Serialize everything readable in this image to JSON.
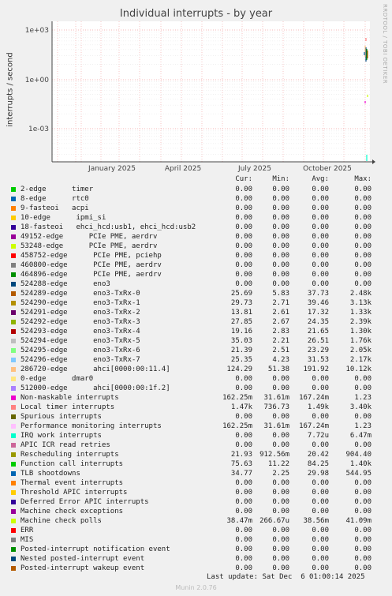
{
  "title": "Individual interrupts - by year",
  "side_label": "RRDTOOL / TOBI OETIKER",
  "chart_data": {
    "type": "line",
    "title": "Individual interrupts - by year",
    "ylabel": "interrupts / second",
    "yscale": "log",
    "y_ticks": [
      "1e+03",
      "1e+00",
      "1e-03"
    ],
    "x_ticks": [
      "January 2025",
      "April 2025",
      "July 2025",
      "October 2025"
    ],
    "grid": true,
    "series_note": "data present only at the far right end of the time range"
  },
  "headers": {
    "cur": "Cur:",
    "min": "Min:",
    "avg": "Avg:",
    "max": "Max:"
  },
  "legend": [
    {
      "label": "2-edge      timer",
      "color": "#00cc00",
      "cur": "0.00",
      "min": "0.00",
      "avg": "0.00",
      "max": "0.00"
    },
    {
      "label": "8-edge      rtc0",
      "color": "#0066b3",
      "cur": "0.00",
      "min": "0.00",
      "avg": "0.00",
      "max": "0.00"
    },
    {
      "label": "9-fasteoi   acpi",
      "color": "#ff8000",
      "cur": "0.00",
      "min": "0.00",
      "avg": "0.00",
      "max": "0.00"
    },
    {
      "label": "10-edge      ipmi_si",
      "color": "#ffcc00",
      "cur": "0.00",
      "min": "0.00",
      "avg": "0.00",
      "max": "0.00"
    },
    {
      "label": "18-fasteoi   ehci_hcd:usb1, ehci_hcd:usb2",
      "color": "#330099",
      "cur": "0.00",
      "min": "0.00",
      "avg": "0.00",
      "max": "0.00"
    },
    {
      "label": "49152-edge      PCIe PME, aerdrv",
      "color": "#990099",
      "cur": "0.00",
      "min": "0.00",
      "avg": "0.00",
      "max": "0.00"
    },
    {
      "label": "53248-edge      PCIe PME, aerdrv",
      "color": "#ccff00",
      "cur": "0.00",
      "min": "0.00",
      "avg": "0.00",
      "max": "0.00"
    },
    {
      "label": "458752-edge      PCIe PME, pciehp",
      "color": "#ff0000",
      "cur": "0.00",
      "min": "0.00",
      "avg": "0.00",
      "max": "0.00"
    },
    {
      "label": "460800-edge      PCIe PME, aerdrv",
      "color": "#808080",
      "cur": "0.00",
      "min": "0.00",
      "avg": "0.00",
      "max": "0.00"
    },
    {
      "label": "464896-edge      PCIe PME, aerdrv",
      "color": "#008f00",
      "cur": "0.00",
      "min": "0.00",
      "avg": "0.00",
      "max": "0.00"
    },
    {
      "label": "524288-edge      eno3",
      "color": "#00487d",
      "cur": "0.00",
      "min": "0.00",
      "avg": "0.00",
      "max": "0.00"
    },
    {
      "label": "524289-edge      eno3-TxRx-0",
      "color": "#b35a00",
      "cur": "25.69",
      "min": "5.83",
      "avg": "37.73",
      "max": "2.48k"
    },
    {
      "label": "524290-edge      eno3-TxRx-1",
      "color": "#b38f00",
      "cur": "29.73",
      "min": "2.71",
      "avg": "39.46",
      "max": "3.13k"
    },
    {
      "label": "524291-edge      eno3-TxRx-2",
      "color": "#6b006b",
      "cur": "13.81",
      "min": "2.61",
      "avg": "17.32",
      "max": "1.33k"
    },
    {
      "label": "524292-edge      eno3-TxRx-3",
      "color": "#8fb300",
      "cur": "27.85",
      "min": "2.67",
      "avg": "24.35",
      "max": "2.39k"
    },
    {
      "label": "524293-edge      eno3-TxRx-4",
      "color": "#b30000",
      "cur": "19.16",
      "min": "2.83",
      "avg": "21.65",
      "max": "1.30k"
    },
    {
      "label": "524294-edge      eno3-TxRx-5",
      "color": "#bebebe",
      "cur": "35.03",
      "min": "2.21",
      "avg": "26.51",
      "max": "1.76k"
    },
    {
      "label": "524295-edge      eno3-TxRx-6",
      "color": "#80ff80",
      "cur": "21.39",
      "min": "2.51",
      "avg": "23.29",
      "max": "2.05k"
    },
    {
      "label": "524296-edge      eno3-TxRx-7",
      "color": "#80c9ff",
      "cur": "25.35",
      "min": "4.23",
      "avg": "31.53",
      "max": "2.17k"
    },
    {
      "label": "286720-edge      ahci[0000:00:11.4]",
      "color": "#ffc080",
      "cur": "124.29",
      "min": "51.38",
      "avg": "191.92",
      "max": "10.12k"
    },
    {
      "label": "0-edge      dmar0",
      "color": "#ffe680",
      "cur": "0.00",
      "min": "0.00",
      "avg": "0.00",
      "max": "0.00"
    },
    {
      "label": "512000-edge      ahci[0000:00:1f.2]",
      "color": "#aa80ff",
      "cur": "0.00",
      "min": "0.00",
      "avg": "0.00",
      "max": "0.00"
    },
    {
      "label": "Non-maskable interrupts",
      "color": "#ee00cc",
      "cur": "162.25m",
      "min": "31.61m",
      "avg": "167.24m",
      "max": "1.23"
    },
    {
      "label": "Local timer interrupts",
      "color": "#ff8080",
      "cur": "1.47k",
      "min": "736.73",
      "avg": "1.49k",
      "max": "3.40k"
    },
    {
      "label": "Spurious interrupts",
      "color": "#666600",
      "cur": "0.00",
      "min": "0.00",
      "avg": "0.00",
      "max": "0.00"
    },
    {
      "label": "Performance monitoring interrupts",
      "color": "#ffbfff",
      "cur": "162.25m",
      "min": "31.61m",
      "avg": "167.24m",
      "max": "1.23"
    },
    {
      "label": "IRQ work interrupts",
      "color": "#00ffcc",
      "cur": "0.00",
      "min": "0.00",
      "avg": "7.72u",
      "max": "6.47m"
    },
    {
      "label": "APIC ICR read retries",
      "color": "#cc6699",
      "cur": "0.00",
      "min": "0.00",
      "avg": "0.00",
      "max": "0.00"
    },
    {
      "label": "Rescheduling interrupts",
      "color": "#999900",
      "cur": "21.93",
      "min": "912.56m",
      "avg": "20.42",
      "max": "904.40"
    },
    {
      "label": "Function call interrupts",
      "color": "#00cc00",
      "cur": "75.63",
      "min": "11.22",
      "avg": "84.25",
      "max": "1.40k"
    },
    {
      "label": "TLB shootdowns",
      "color": "#0066b3",
      "cur": "34.77",
      "min": "2.25",
      "avg": "29.98",
      "max": "544.95"
    },
    {
      "label": "Thermal event interrupts",
      "color": "#ff8000",
      "cur": "0.00",
      "min": "0.00",
      "avg": "0.00",
      "max": "0.00"
    },
    {
      "label": "Threshold APIC interrupts",
      "color": "#ffcc00",
      "cur": "0.00",
      "min": "0.00",
      "avg": "0.00",
      "max": "0.00"
    },
    {
      "label": "Deferred Error APIC interrupts",
      "color": "#330099",
      "cur": "0.00",
      "min": "0.00",
      "avg": "0.00",
      "max": "0.00"
    },
    {
      "label": "Machine check exceptions",
      "color": "#990099",
      "cur": "0.00",
      "min": "0.00",
      "avg": "0.00",
      "max": "0.00"
    },
    {
      "label": "Machine check polls",
      "color": "#ccff00",
      "cur": "38.47m",
      "min": "266.67u",
      "avg": "38.56m",
      "max": "41.09m"
    },
    {
      "label": "ERR",
      "color": "#ff0000",
      "cur": "0.00",
      "min": "0.00",
      "avg": "0.00",
      "max": "0.00"
    },
    {
      "label": "MIS",
      "color": "#808080",
      "cur": "0.00",
      "min": "0.00",
      "avg": "0.00",
      "max": "0.00"
    },
    {
      "label": "Posted-interrupt notification event",
      "color": "#008f00",
      "cur": "0.00",
      "min": "0.00",
      "avg": "0.00",
      "max": "0.00"
    },
    {
      "label": "Nested posted-interrupt event",
      "color": "#00487d",
      "cur": "0.00",
      "min": "0.00",
      "avg": "0.00",
      "max": "0.00"
    },
    {
      "label": "Posted-interrupt wakeup event",
      "color": "#b35a00",
      "cur": "0.00",
      "min": "0.00",
      "avg": "0.00",
      "max": "0.00"
    }
  ],
  "last_update": "Last update: Sat Dec  6 01:00:14 2025",
  "footer": "Munin 2.0.76"
}
